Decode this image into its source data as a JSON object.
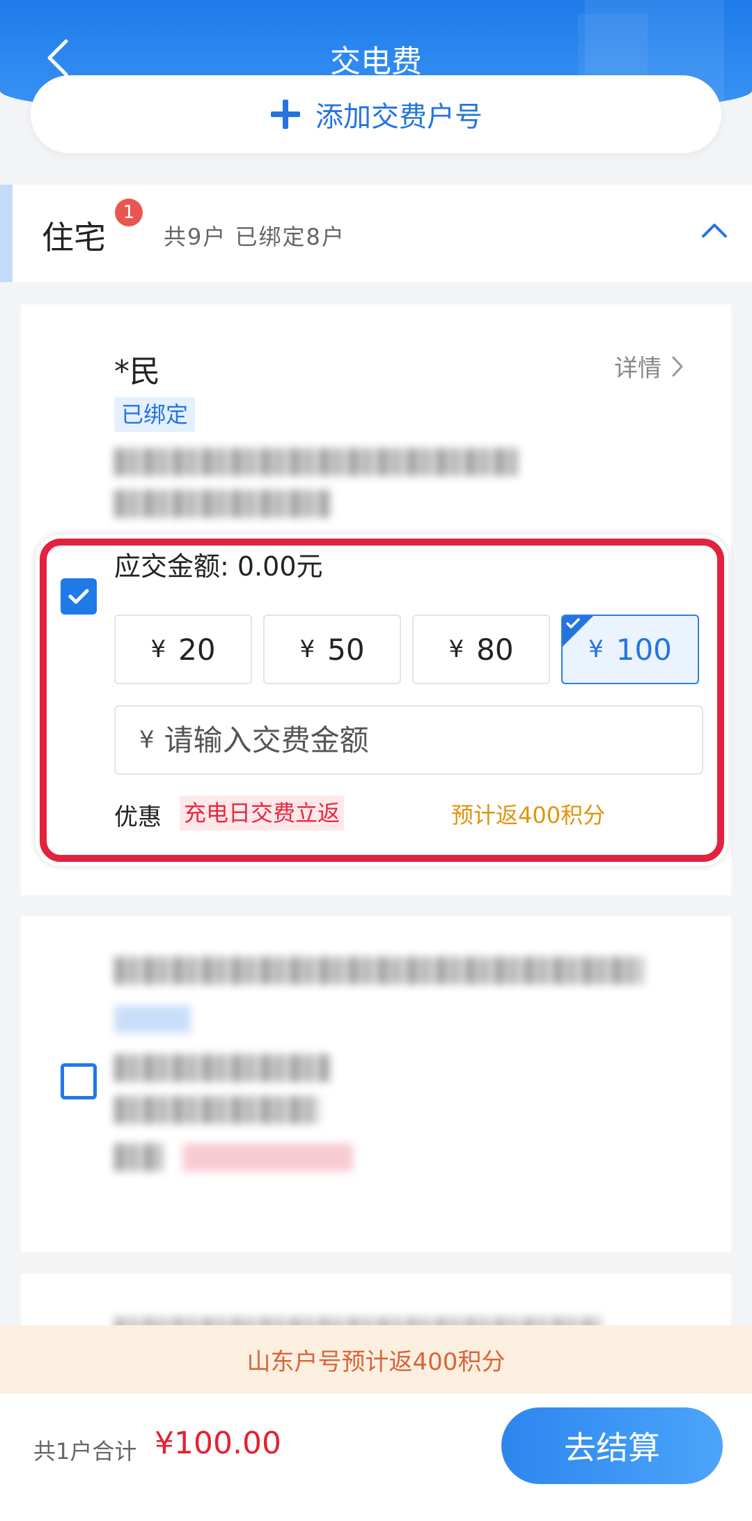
{
  "header": {
    "title": "交电费",
    "add_account_label": "添加交费户号"
  },
  "section": {
    "title": "住宅",
    "badge_count": "1",
    "summary": "共9户 已绑定8户"
  },
  "account1": {
    "name": "*民",
    "detail_label": "详情",
    "status_tag": "已绑定",
    "checked": true,
    "due_label": "应交金额: 0.00元",
    "amount_options": [
      {
        "currency": "¥",
        "value": "20"
      },
      {
        "currency": "¥",
        "value": "50"
      },
      {
        "currency": "¥",
        "value": "80"
      },
      {
        "currency": "¥",
        "value": "100"
      }
    ],
    "selected_amount": "100",
    "input_currency": "¥",
    "input_placeholder": "请输入交费金额",
    "promo_label": "优惠",
    "promo_tag": "充电日交费立返",
    "points_text": "预计返400积分"
  },
  "account2": {
    "checked": false
  },
  "notice": {
    "text": "山东户号预计返400积分"
  },
  "footer": {
    "total_label": "共1户合计",
    "total_value": "¥100.00",
    "checkout_label": "去结算"
  },
  "colors": {
    "brand_blue": "#2474e0",
    "highlight_red": "#e3223d",
    "price_red": "#e8202d",
    "points_orange": "#e0940c"
  }
}
